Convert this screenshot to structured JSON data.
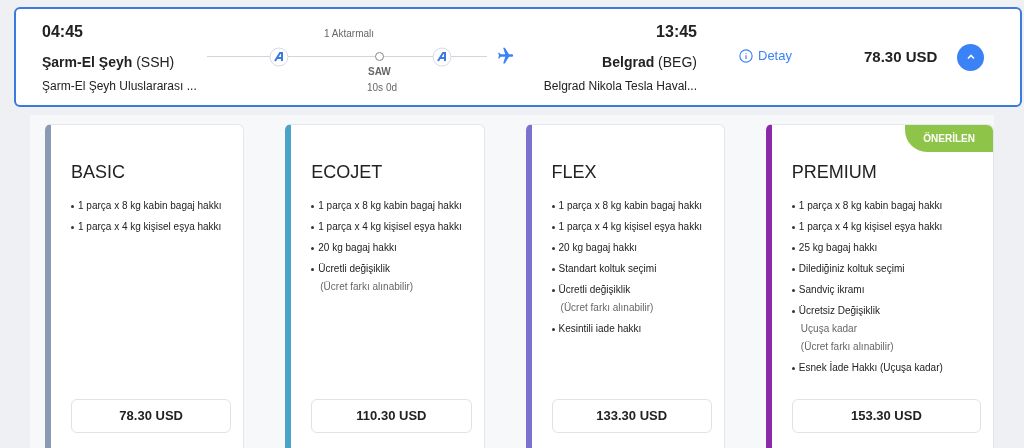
{
  "flight": {
    "departure": {
      "time": "04:45",
      "city": "**Şarm-El Şeyh** (SSH)",
      "airport": "Şarm-El Şeyh Uluslararası ..."
    },
    "route": {
      "stops_label": "1 Aktarmalı",
      "stop_code": "SAW",
      "duration": "10s 0d"
    },
    "arrival": {
      "time": "13:45",
      "city": "**Belgrad** (BEG)",
      "airport": "Belgrad Nikola Tesla Haval..."
    },
    "detail_link": "Detay",
    "price": "78.30 USD",
    "expanded": true
  },
  "fares": [
    {
      "name": "BASIC",
      "color": "#8a9ab5",
      "features": [
        {
          "text": "1 parça x 8 kg kabin bagaj hakkı"
        },
        {
          "text": "1 parça x 4 kg kişisel eşya hakkı"
        }
      ],
      "price": "78.30 USD"
    },
    {
      "name": "ECOJET",
      "color": "#4aa3c9",
      "features": [
        {
          "text": "1 parça x 8 kg kabin bagaj hakkı"
        },
        {
          "text": "1 parça x 4 kg kişisel eşya hakkı"
        },
        {
          "text": "20 kg bagaj hakkı"
        },
        {
          "text": "Ücretli değişiklik",
          "notes": [
            "(Ücret farkı alınabilir)"
          ]
        }
      ],
      "price": "110.30 USD"
    },
    {
      "name": "FLEX",
      "color": "#7a72cc",
      "features": [
        {
          "text": "1 parça x 8 kg kabin bagaj hakkı"
        },
        {
          "text": "1 parça x 4 kg kişisel eşya hakkı"
        },
        {
          "text": "20 kg bagaj hakkı"
        },
        {
          "text": "Standart koltuk seçimi"
        },
        {
          "text": "Ücretli değişiklik",
          "notes": [
            "(Ücret farkı alınabilir)"
          ]
        },
        {
          "text": "Kesintili iade hakkı"
        }
      ],
      "price": "133.30 USD"
    },
    {
      "name": "PREMIUM",
      "color": "#8a2aa8",
      "badge": "ÖNERİLEN",
      "features": [
        {
          "text": "1 parça x 8 kg kabin bagaj hakkı"
        },
        {
          "text": "1 parça x 4 kg kişisel eşya hakkı"
        },
        {
          "text": "25 kg bagaj hakkı"
        },
        {
          "text": "Dilediğiniz koltuk seçimi"
        },
        {
          "text": "Sandviç ikramı"
        },
        {
          "text": "Ücretsiz Değişiklik",
          "notes": [
            "Uçuşa kadar",
            "(Ücret farkı alınabilir)"
          ]
        },
        {
          "text": "Esnek İade Hakkı (Uçuşa kadar)"
        }
      ],
      "price": "153.30 USD"
    }
  ]
}
